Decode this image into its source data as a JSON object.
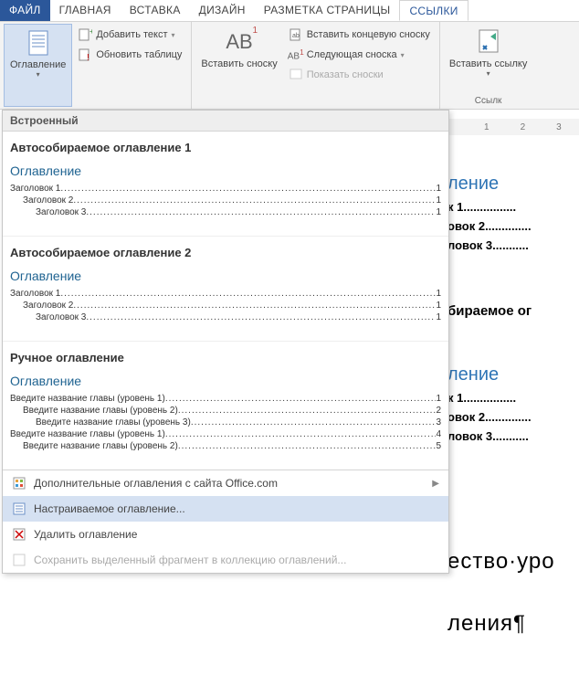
{
  "tabs": {
    "file": "ФАЙЛ",
    "home": "ГЛАВНАЯ",
    "insert": "ВСТАВКА",
    "design": "ДИЗАЙН",
    "layout": "РАЗМЕТКА СТРАНИЦЫ",
    "references": "ССЫЛКИ"
  },
  "ribbon": {
    "toc_button": "Оглавление",
    "add_text": "Добавить текст",
    "update_table": "Обновить таблицу",
    "insert_footnote_big": "Вставить сноску",
    "ab_sub": "AB",
    "insert_endnote": "Вставить концевую сноску",
    "next_footnote": "Следующая сноска",
    "show_notes": "Показать сноски",
    "insert_link_big": "Вставить ссылку",
    "links_group": "Ссылк"
  },
  "gallery": {
    "header": "Встроенный",
    "auto1": {
      "title": "Автособираемое оглавление 1",
      "toc_heading": "Оглавление",
      "rows": [
        {
          "label": "Заголовок 1",
          "indent": 0,
          "page": "1"
        },
        {
          "label": "Заголовок 2",
          "indent": 1,
          "page": "1"
        },
        {
          "label": "Заголовок 3",
          "indent": 2,
          "page": "1"
        }
      ]
    },
    "auto2": {
      "title": "Автособираемое оглавление 2",
      "toc_heading": "Оглавление",
      "rows": [
        {
          "label": "Заголовок 1",
          "indent": 0,
          "page": "1"
        },
        {
          "label": "Заголовок 2",
          "indent": 1,
          "page": "1"
        },
        {
          "label": "Заголовок 3",
          "indent": 2,
          "page": "1"
        }
      ]
    },
    "manual": {
      "title": "Ручное оглавление",
      "toc_heading": "Оглавление",
      "rows": [
        {
          "label": "Введите название главы (уровень 1)",
          "indent": 0,
          "page": "1"
        },
        {
          "label": "Введите название главы (уровень 2)",
          "indent": 1,
          "page": "2"
        },
        {
          "label": "Введите название главы (уровень 3)",
          "indent": 2,
          "page": "3"
        },
        {
          "label": "Введите название главы (уровень 1)",
          "indent": 0,
          "page": "4"
        },
        {
          "label": "Введите название главы (уровень 2)",
          "indent": 1,
          "page": "5"
        }
      ]
    },
    "menu": {
      "more_office": "Дополнительные оглавления с сайта Office.com",
      "custom": "Настраиваемое оглавление...",
      "remove": "Удалить оглавление",
      "save_selection": "Сохранить выделенный фрагмент в коллекцию оглавлений..."
    }
  },
  "ruler": {
    "n1": "1",
    "n2": "2",
    "n3": "3"
  },
  "doc_bg": {
    "heading1": "ление",
    "row1": "к 1",
    "row2": "овок 2",
    "row3": "ловок 3",
    "heading2": "бираемое ог",
    "heading3": "ление",
    "row1b": "к 1",
    "row2b": "овок 2",
    "row3b": "ловок 3",
    "big1": "ество·уро",
    "big2": "ления¶"
  },
  "dots": "............................................................................................................................................................................"
}
